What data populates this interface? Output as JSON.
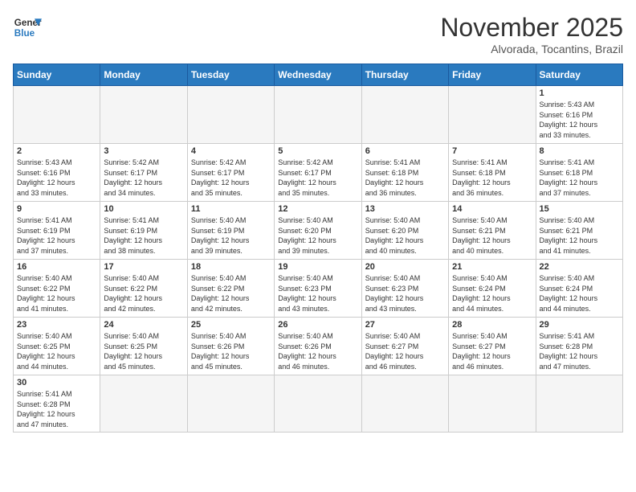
{
  "logo": {
    "line1": "General",
    "line2": "Blue"
  },
  "title": "November 2025",
  "subtitle": "Alvorada, Tocantins, Brazil",
  "weekdays": [
    "Sunday",
    "Monday",
    "Tuesday",
    "Wednesday",
    "Thursday",
    "Friday",
    "Saturday"
  ],
  "weeks": [
    [
      {
        "day": "",
        "info": ""
      },
      {
        "day": "",
        "info": ""
      },
      {
        "day": "",
        "info": ""
      },
      {
        "day": "",
        "info": ""
      },
      {
        "day": "",
        "info": ""
      },
      {
        "day": "",
        "info": ""
      },
      {
        "day": "1",
        "info": "Sunrise: 5:43 AM\nSunset: 6:16 PM\nDaylight: 12 hours\nand 33 minutes."
      }
    ],
    [
      {
        "day": "2",
        "info": "Sunrise: 5:43 AM\nSunset: 6:16 PM\nDaylight: 12 hours\nand 33 minutes."
      },
      {
        "day": "3",
        "info": "Sunrise: 5:42 AM\nSunset: 6:17 PM\nDaylight: 12 hours\nand 34 minutes."
      },
      {
        "day": "4",
        "info": "Sunrise: 5:42 AM\nSunset: 6:17 PM\nDaylight: 12 hours\nand 35 minutes."
      },
      {
        "day": "5",
        "info": "Sunrise: 5:42 AM\nSunset: 6:17 PM\nDaylight: 12 hours\nand 35 minutes."
      },
      {
        "day": "6",
        "info": "Sunrise: 5:41 AM\nSunset: 6:18 PM\nDaylight: 12 hours\nand 36 minutes."
      },
      {
        "day": "7",
        "info": "Sunrise: 5:41 AM\nSunset: 6:18 PM\nDaylight: 12 hours\nand 36 minutes."
      },
      {
        "day": "8",
        "info": "Sunrise: 5:41 AM\nSunset: 6:18 PM\nDaylight: 12 hours\nand 37 minutes."
      }
    ],
    [
      {
        "day": "9",
        "info": "Sunrise: 5:41 AM\nSunset: 6:19 PM\nDaylight: 12 hours\nand 37 minutes."
      },
      {
        "day": "10",
        "info": "Sunrise: 5:41 AM\nSunset: 6:19 PM\nDaylight: 12 hours\nand 38 minutes."
      },
      {
        "day": "11",
        "info": "Sunrise: 5:40 AM\nSunset: 6:19 PM\nDaylight: 12 hours\nand 39 minutes."
      },
      {
        "day": "12",
        "info": "Sunrise: 5:40 AM\nSunset: 6:20 PM\nDaylight: 12 hours\nand 39 minutes."
      },
      {
        "day": "13",
        "info": "Sunrise: 5:40 AM\nSunset: 6:20 PM\nDaylight: 12 hours\nand 40 minutes."
      },
      {
        "day": "14",
        "info": "Sunrise: 5:40 AM\nSunset: 6:21 PM\nDaylight: 12 hours\nand 40 minutes."
      },
      {
        "day": "15",
        "info": "Sunrise: 5:40 AM\nSunset: 6:21 PM\nDaylight: 12 hours\nand 41 minutes."
      }
    ],
    [
      {
        "day": "16",
        "info": "Sunrise: 5:40 AM\nSunset: 6:22 PM\nDaylight: 12 hours\nand 41 minutes."
      },
      {
        "day": "17",
        "info": "Sunrise: 5:40 AM\nSunset: 6:22 PM\nDaylight: 12 hours\nand 42 minutes."
      },
      {
        "day": "18",
        "info": "Sunrise: 5:40 AM\nSunset: 6:22 PM\nDaylight: 12 hours\nand 42 minutes."
      },
      {
        "day": "19",
        "info": "Sunrise: 5:40 AM\nSunset: 6:23 PM\nDaylight: 12 hours\nand 43 minutes."
      },
      {
        "day": "20",
        "info": "Sunrise: 5:40 AM\nSunset: 6:23 PM\nDaylight: 12 hours\nand 43 minutes."
      },
      {
        "day": "21",
        "info": "Sunrise: 5:40 AM\nSunset: 6:24 PM\nDaylight: 12 hours\nand 44 minutes."
      },
      {
        "day": "22",
        "info": "Sunrise: 5:40 AM\nSunset: 6:24 PM\nDaylight: 12 hours\nand 44 minutes."
      }
    ],
    [
      {
        "day": "23",
        "info": "Sunrise: 5:40 AM\nSunset: 6:25 PM\nDaylight: 12 hours\nand 44 minutes."
      },
      {
        "day": "24",
        "info": "Sunrise: 5:40 AM\nSunset: 6:25 PM\nDaylight: 12 hours\nand 45 minutes."
      },
      {
        "day": "25",
        "info": "Sunrise: 5:40 AM\nSunset: 6:26 PM\nDaylight: 12 hours\nand 45 minutes."
      },
      {
        "day": "26",
        "info": "Sunrise: 5:40 AM\nSunset: 6:26 PM\nDaylight: 12 hours\nand 46 minutes."
      },
      {
        "day": "27",
        "info": "Sunrise: 5:40 AM\nSunset: 6:27 PM\nDaylight: 12 hours\nand 46 minutes."
      },
      {
        "day": "28",
        "info": "Sunrise: 5:40 AM\nSunset: 6:27 PM\nDaylight: 12 hours\nand 46 minutes."
      },
      {
        "day": "29",
        "info": "Sunrise: 5:41 AM\nSunset: 6:28 PM\nDaylight: 12 hours\nand 47 minutes."
      }
    ],
    [
      {
        "day": "30",
        "info": "Sunrise: 5:41 AM\nSunset: 6:28 PM\nDaylight: 12 hours\nand 47 minutes."
      },
      {
        "day": "",
        "info": ""
      },
      {
        "day": "",
        "info": ""
      },
      {
        "day": "",
        "info": ""
      },
      {
        "day": "",
        "info": ""
      },
      {
        "day": "",
        "info": ""
      },
      {
        "day": "",
        "info": ""
      }
    ]
  ]
}
